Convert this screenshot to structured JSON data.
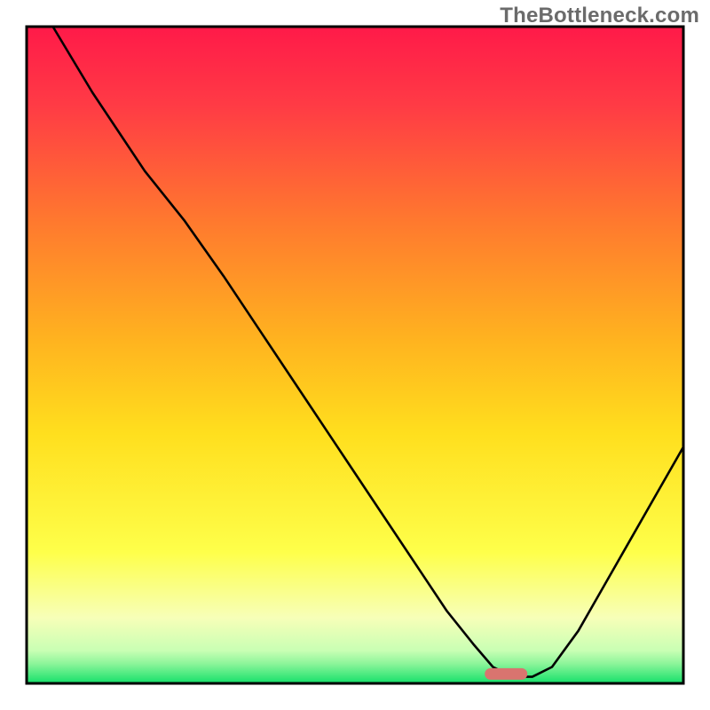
{
  "watermark": "TheBottleneck.com",
  "chart_data": {
    "type": "line",
    "title": "",
    "xlabel": "",
    "ylabel": "",
    "xlim": [
      0,
      100
    ],
    "ylim": [
      0,
      100
    ],
    "grid": false,
    "legend": false,
    "background_gradient": {
      "top_color": "#ff1a49",
      "mid_color": "#ffdf1e",
      "bottom_near_color": "#f7ffb8",
      "bottom_color": "#15e06a"
    },
    "annotations": [
      {
        "type": "marker",
        "shape": "rounded-bar",
        "x": 73,
        "y": 1.5,
        "color": "#d9746f"
      }
    ],
    "series": [
      {
        "name": "bottleneck-curve",
        "color": "#000000",
        "x": [
          4,
          10,
          18,
          24,
          30,
          36,
          42,
          48,
          54,
          60,
          64,
          68,
          71,
          74,
          77,
          80,
          84,
          88,
          92,
          96,
          100
        ],
        "y": [
          100,
          90,
          78,
          70.5,
          62,
          53,
          44,
          35,
          26,
          17,
          11,
          6,
          2.5,
          1,
          1,
          2.5,
          8,
          15,
          22,
          29,
          36
        ]
      }
    ]
  }
}
